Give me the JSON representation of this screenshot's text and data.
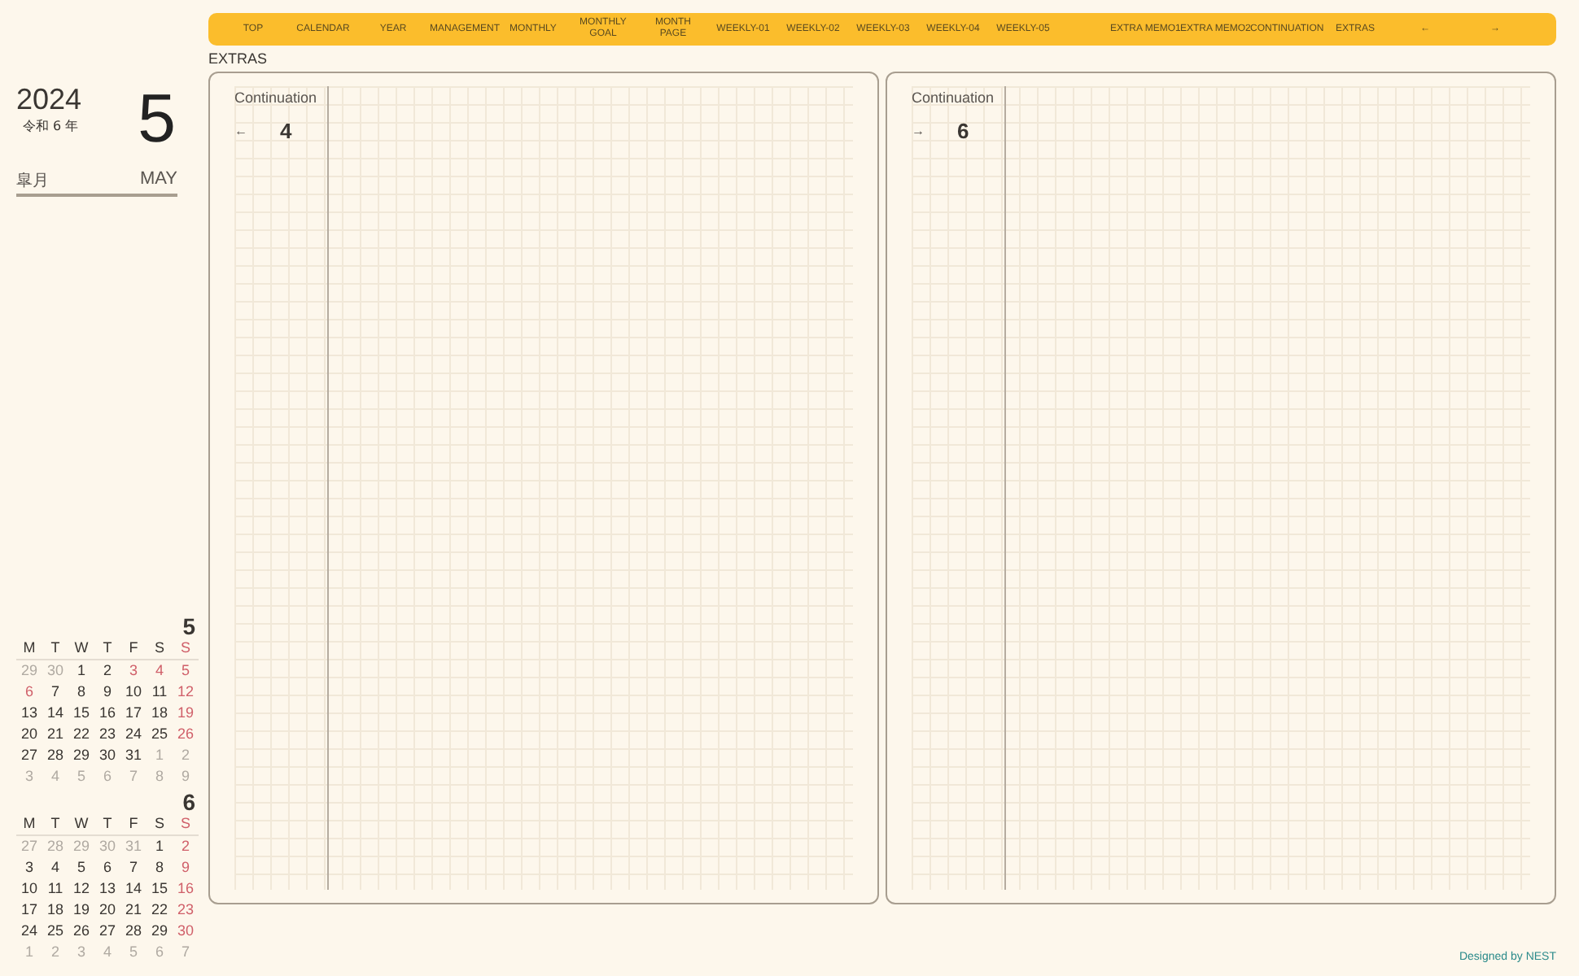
{
  "nav": {
    "left": [
      "TOP",
      "CALENDAR",
      "YEAR",
      "MANAGEMENT",
      "MONTHLY",
      "MONTHLY GOAL",
      "MONTH PAGE",
      "WEEKLY-01",
      "WEEKLY-02",
      "WEEKLY-03",
      "WEEKLY-04",
      "WEEKLY-05"
    ],
    "right": [
      "EXTRA MEMO1",
      "EXTRA MEMO2",
      "CONTINUATION",
      "EXTRAS",
      "←",
      "→"
    ]
  },
  "section_title": "EXTRAS",
  "date": {
    "year": "2024",
    "era": "令和 6 年",
    "day": "5",
    "month_jp": "皐月",
    "month_en": "MAY"
  },
  "pages": [
    {
      "label": "Continuation",
      "arrow": "←",
      "number": "4"
    },
    {
      "label": "Continuation",
      "arrow": "→",
      "number": "6"
    }
  ],
  "calendars": [
    {
      "month": "5",
      "weekdays": [
        {
          "label": "M",
          "kind": "normal"
        },
        {
          "label": "T",
          "kind": "normal"
        },
        {
          "label": "W",
          "kind": "normal"
        },
        {
          "label": "T",
          "kind": "normal"
        },
        {
          "label": "F",
          "kind": "normal"
        },
        {
          "label": "S",
          "kind": "normal"
        },
        {
          "label": "S",
          "kind": "holiday"
        }
      ],
      "weeks": [
        [
          {
            "d": "29",
            "kind": "other"
          },
          {
            "d": "30",
            "kind": "other"
          },
          {
            "d": "1",
            "kind": "normal"
          },
          {
            "d": "2",
            "kind": "normal"
          },
          {
            "d": "3",
            "kind": "holiday"
          },
          {
            "d": "4",
            "kind": "holiday"
          },
          {
            "d": "5",
            "kind": "holiday"
          }
        ],
        [
          {
            "d": "6",
            "kind": "holiday"
          },
          {
            "d": "7",
            "kind": "normal"
          },
          {
            "d": "8",
            "kind": "normal"
          },
          {
            "d": "9",
            "kind": "normal"
          },
          {
            "d": "10",
            "kind": "normal"
          },
          {
            "d": "11",
            "kind": "normal"
          },
          {
            "d": "12",
            "kind": "holiday"
          }
        ],
        [
          {
            "d": "13",
            "kind": "normal"
          },
          {
            "d": "14",
            "kind": "normal"
          },
          {
            "d": "15",
            "kind": "normal"
          },
          {
            "d": "16",
            "kind": "normal"
          },
          {
            "d": "17",
            "kind": "normal"
          },
          {
            "d": "18",
            "kind": "normal"
          },
          {
            "d": "19",
            "kind": "holiday"
          }
        ],
        [
          {
            "d": "20",
            "kind": "normal"
          },
          {
            "d": "21",
            "kind": "normal"
          },
          {
            "d": "22",
            "kind": "normal"
          },
          {
            "d": "23",
            "kind": "normal"
          },
          {
            "d": "24",
            "kind": "normal"
          },
          {
            "d": "25",
            "kind": "normal"
          },
          {
            "d": "26",
            "kind": "holiday"
          }
        ],
        [
          {
            "d": "27",
            "kind": "normal"
          },
          {
            "d": "28",
            "kind": "normal"
          },
          {
            "d": "29",
            "kind": "normal"
          },
          {
            "d": "30",
            "kind": "normal"
          },
          {
            "d": "31",
            "kind": "normal"
          },
          {
            "d": "1",
            "kind": "other"
          },
          {
            "d": "2",
            "kind": "other"
          }
        ],
        [
          {
            "d": "3",
            "kind": "other"
          },
          {
            "d": "4",
            "kind": "other"
          },
          {
            "d": "5",
            "kind": "other"
          },
          {
            "d": "6",
            "kind": "other"
          },
          {
            "d": "7",
            "kind": "other"
          },
          {
            "d": "8",
            "kind": "other"
          },
          {
            "d": "9",
            "kind": "other"
          }
        ]
      ]
    },
    {
      "month": "6",
      "weekdays": [
        {
          "label": "M",
          "kind": "normal"
        },
        {
          "label": "T",
          "kind": "normal"
        },
        {
          "label": "W",
          "kind": "normal"
        },
        {
          "label": "T",
          "kind": "normal"
        },
        {
          "label": "F",
          "kind": "normal"
        },
        {
          "label": "S",
          "kind": "normal"
        },
        {
          "label": "S",
          "kind": "holiday"
        }
      ],
      "weeks": [
        [
          {
            "d": "27",
            "kind": "other"
          },
          {
            "d": "28",
            "kind": "other"
          },
          {
            "d": "29",
            "kind": "other"
          },
          {
            "d": "30",
            "kind": "other"
          },
          {
            "d": "31",
            "kind": "other"
          },
          {
            "d": "1",
            "kind": "normal"
          },
          {
            "d": "2",
            "kind": "holiday"
          }
        ],
        [
          {
            "d": "3",
            "kind": "normal"
          },
          {
            "d": "4",
            "kind": "normal"
          },
          {
            "d": "5",
            "kind": "normal"
          },
          {
            "d": "6",
            "kind": "normal"
          },
          {
            "d": "7",
            "kind": "normal"
          },
          {
            "d": "8",
            "kind": "normal"
          },
          {
            "d": "9",
            "kind": "holiday"
          }
        ],
        [
          {
            "d": "10",
            "kind": "normal"
          },
          {
            "d": "11",
            "kind": "normal"
          },
          {
            "d": "12",
            "kind": "normal"
          },
          {
            "d": "13",
            "kind": "normal"
          },
          {
            "d": "14",
            "kind": "normal"
          },
          {
            "d": "15",
            "kind": "normal"
          },
          {
            "d": "16",
            "kind": "holiday"
          }
        ],
        [
          {
            "d": "17",
            "kind": "normal"
          },
          {
            "d": "18",
            "kind": "normal"
          },
          {
            "d": "19",
            "kind": "normal"
          },
          {
            "d": "20",
            "kind": "normal"
          },
          {
            "d": "21",
            "kind": "normal"
          },
          {
            "d": "22",
            "kind": "normal"
          },
          {
            "d": "23",
            "kind": "holiday"
          }
        ],
        [
          {
            "d": "24",
            "kind": "normal"
          },
          {
            "d": "25",
            "kind": "normal"
          },
          {
            "d": "26",
            "kind": "normal"
          },
          {
            "d": "27",
            "kind": "normal"
          },
          {
            "d": "28",
            "kind": "normal"
          },
          {
            "d": "29",
            "kind": "normal"
          },
          {
            "d": "30",
            "kind": "holiday"
          }
        ],
        [
          {
            "d": "1",
            "kind": "other"
          },
          {
            "d": "2",
            "kind": "other"
          },
          {
            "d": "3",
            "kind": "other"
          },
          {
            "d": "4",
            "kind": "other"
          },
          {
            "d": "5",
            "kind": "other"
          },
          {
            "d": "6",
            "kind": "other"
          },
          {
            "d": "7",
            "kind": "other"
          }
        ]
      ]
    }
  ],
  "credit": "Designed by NEST"
}
